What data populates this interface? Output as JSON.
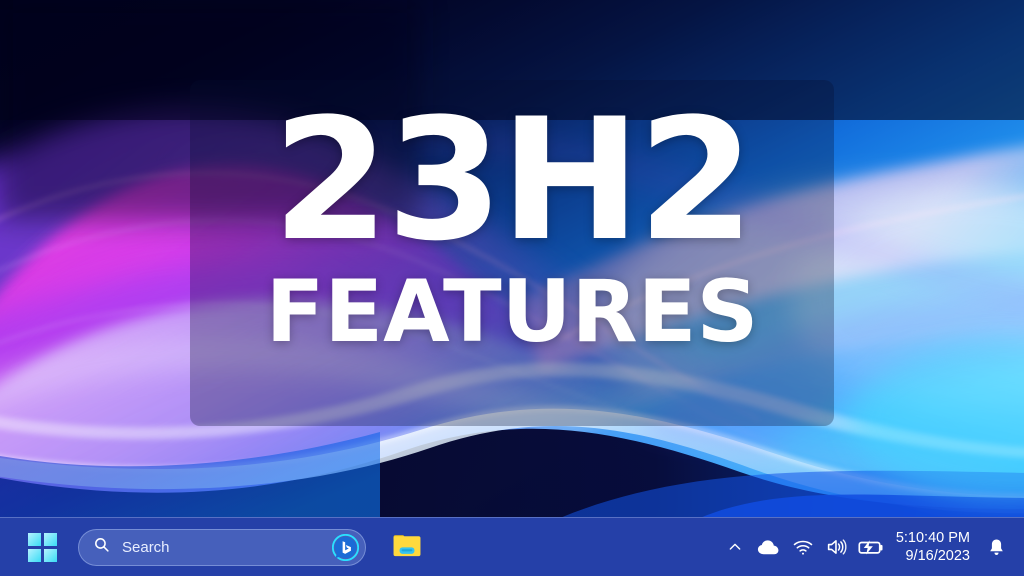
{
  "desktop": {
    "wallpaper_name": "abstract-waves-wallpaper",
    "overlay_title_main": "23H2",
    "overlay_title_sub": "FEATURES"
  },
  "taskbar": {
    "background_color": "#2540a8",
    "start": {
      "name": "Start",
      "icon": "windows-logo-icon",
      "accent_color": "#39dcf5"
    },
    "search": {
      "placeholder": "Search",
      "value": "",
      "search_icon": "search-icon",
      "assistant_icon": "bing-chat-icon",
      "assistant_accent": "#00d4ff"
    },
    "pinned": [
      {
        "name": "File Explorer",
        "icon": "folder-icon",
        "color": "#ffd43b"
      }
    ],
    "tray": [
      {
        "name": "Show hidden icons",
        "icon": "chevron-up-icon"
      },
      {
        "name": "OneDrive",
        "icon": "cloud-icon"
      },
      {
        "name": "Network",
        "icon": "wifi-icon"
      },
      {
        "name": "Volume",
        "icon": "speaker-icon"
      },
      {
        "name": "Battery charging",
        "icon": "battery-charging-icon"
      }
    ],
    "clock": {
      "time": "5:10:40 PM",
      "date": "9/16/2023"
    },
    "notifications": {
      "name": "Notifications",
      "icon": "bell-icon"
    }
  }
}
